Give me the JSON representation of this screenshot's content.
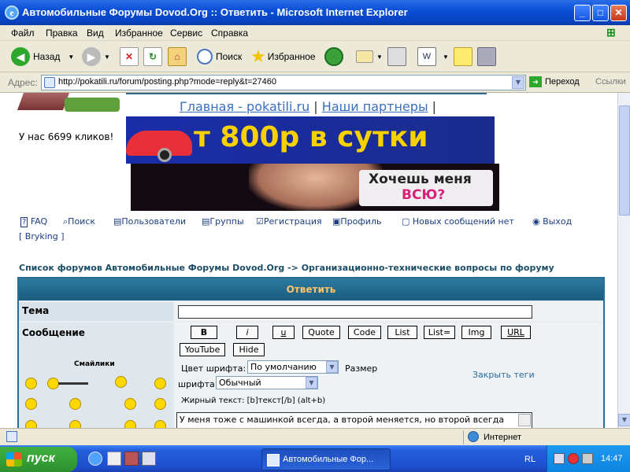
{
  "window": {
    "title": "Автомобильные Форумы Dovod.Org :: Ответить - Microsoft Internet Explorer"
  },
  "menu": [
    "Файл",
    "Правка",
    "Вид",
    "Избранное",
    "Сервис",
    "Справка"
  ],
  "toolbar": {
    "back": "Назад",
    "search": "Поиск",
    "favorites": "Избранное"
  },
  "address": {
    "label": "Адрес:",
    "url": "http://pokatili.ru/forum/posting.php?mode=reply&t=27460",
    "go": "Переход",
    "links": "Ссылки"
  },
  "header": {
    "home_link": "Главная - pokatili.ru",
    "partners_link": "Наши партнеры",
    "separator": "|",
    "clicks": "У нас 6699 кликов!"
  },
  "banners": {
    "top_text": "т 800р в сутки",
    "bottom_line1": "Хочешь меня",
    "bottom_line2": "ВСЮ?"
  },
  "nav": {
    "faq": "FAQ",
    "search": "Поиск",
    "users": "Пользователи",
    "groups": "Группы",
    "register": "Регистрация",
    "profile": "Профиль",
    "new": "Новых сообщений нет",
    "logout": "Выход",
    "user": "[ Bryking ]"
  },
  "breadcrumb": {
    "index": "Список форумов Автомобильные Форумы Dovod.Org",
    "arrow": "->",
    "forum": "Организационно-технические вопросы по форуму"
  },
  "form": {
    "heading": "Ответить",
    "subject_label": "Тема",
    "message_label": "Сообщение",
    "smilies_label": "Смайлики",
    "buttons": [
      "B",
      "i",
      "u",
      "Quote",
      "Code",
      "List",
      "List=",
      "Img",
      "URL"
    ],
    "buttons2": [
      "YouTube",
      "Hide"
    ],
    "font_color_label": "Цвет шрифта:",
    "font_color_value": "По умолчанию",
    "size_label": "Размер",
    "size_label2": "шрифта:",
    "size_value": "Обычный",
    "close_tags": "Закрыть теги",
    "hint": "Жирный текст: [b]текст[/b]  (alt+b)",
    "message_text": "У меня тоже с машинкой всегда, а второй меняется, но второй всегда"
  },
  "status": {
    "zone": "Интернет"
  },
  "taskbar": {
    "start": "пуск",
    "task": "Автомобильные Фор...",
    "lang": "RL",
    "clock": "14:47"
  }
}
